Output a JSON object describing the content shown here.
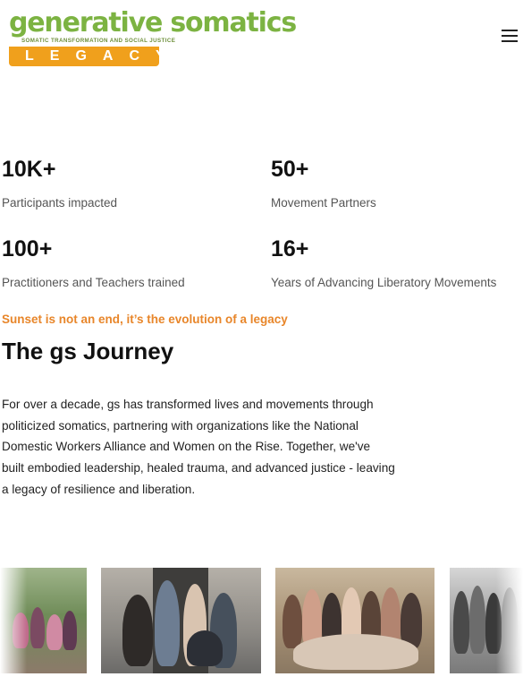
{
  "header": {
    "logo": {
      "wordmark": "generative somatics",
      "subtitle": "SOMATIC TRANSFORMATION AND SOCIAL JUSTICE",
      "legacy": "LEGACY"
    },
    "menu_icon": "hamburger-menu-icon"
  },
  "stats": [
    {
      "value": "10K+",
      "label": "Participants impacted"
    },
    {
      "value": "50+",
      "label": "Movement Partners"
    },
    {
      "value": "100+",
      "label": "Practitioners and Teachers trained"
    },
    {
      "value": "16+",
      "label": "Years of Advancing Liberatory Movements"
    }
  ],
  "journey": {
    "tagline": "Sunset is not an end, it’s the evolution of a legacy",
    "heading": "The gs Journey",
    "body": "For over a decade, gs has transformed lives and movements through politicized somatics, partnering with organizations like the National Domestic Workers Alliance and Women on the Rise. Together, we've built embodied leadership, healed trauma, and advanced justice - leaving a legacy of resilience and liberation."
  },
  "gallery": [
    {
      "name": "group-photo-outdoor"
    },
    {
      "name": "group-photo-doorway"
    },
    {
      "name": "group-photo-indoor"
    },
    {
      "name": "group-photo-bw"
    }
  ],
  "colors": {
    "brand_green": "#7cb342",
    "brand_orange": "#f0a01c",
    "accent_orange": "#e8862a"
  }
}
